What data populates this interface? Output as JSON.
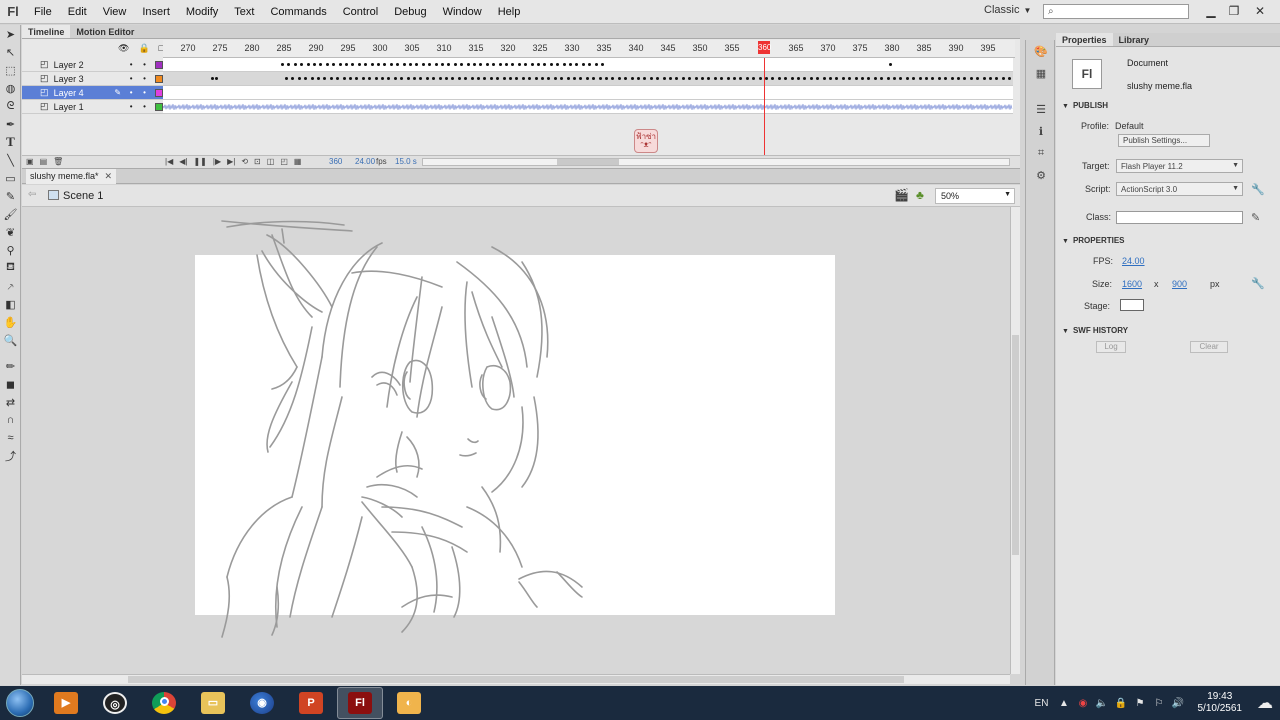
{
  "app": {
    "logo": "Fl",
    "menu": [
      "File",
      "Edit",
      "View",
      "Insert",
      "Modify",
      "Text",
      "Commands",
      "Control",
      "Debug",
      "Window",
      "Help"
    ],
    "workspace": "Classic",
    "window_controls": [
      "minimize-icon",
      "restore-icon",
      "close-icon"
    ]
  },
  "timeline": {
    "tabs": [
      "Timeline",
      "Motion Editor"
    ],
    "frame_ticks": [
      "270",
      "275",
      "280",
      "285",
      "290",
      "295",
      "300",
      "305",
      "310",
      "315",
      "320",
      "325",
      "330",
      "335",
      "340",
      "345",
      "350",
      "355",
      "360",
      "365",
      "370",
      "375",
      "380",
      "385",
      "390",
      "395"
    ],
    "current_frame_marker": "360",
    "layers": [
      {
        "name": "Layer 2",
        "color": "#a030c0",
        "selected": false
      },
      {
        "name": "Layer 3",
        "color": "#f08a20",
        "selected": false
      },
      {
        "name": "Layer 4",
        "color": "#e040e0",
        "selected": true
      },
      {
        "name": "Layer 1",
        "color": "#40c040",
        "selected": false
      }
    ],
    "footer": {
      "current_frame": "360",
      "fps": "24.00",
      "fps_unit": "fps",
      "elapsed": "15.0 s"
    },
    "onion_sprite_text": "ฟ้าซ่า"
  },
  "document": {
    "tab_title": "slushy meme.fla*",
    "scene": "Scene 1",
    "zoom": "50%"
  },
  "properties": {
    "tabs": [
      "Properties",
      "Library"
    ],
    "doc_type": "Document",
    "doc_name": "slushy meme.fla",
    "publish": {
      "header": "PUBLISH",
      "profile_label": "Profile:",
      "profile_value": "Default",
      "settings_button": "Publish Settings...",
      "target_label": "Target:",
      "target_value": "Flash Player 11.2",
      "script_label": "Script:",
      "script_value": "ActionScript 3.0",
      "class_label": "Class:"
    },
    "doc_props": {
      "header": "PROPERTIES",
      "fps_label": "FPS:",
      "fps_value": "24.00",
      "size_label": "Size:",
      "width": "1600",
      "x": "x",
      "height": "900",
      "unit": "px",
      "stage_label": "Stage:",
      "stage_color": "#ffffff"
    },
    "swf_history": {
      "header": "SWF HISTORY",
      "log_button": "Log",
      "clear_button": "Clear"
    }
  },
  "taskbar": {
    "apps": [
      "windows-media-player",
      "obs-studio",
      "chrome",
      "file-explorer",
      "firefox",
      "powerpoint",
      "flash",
      "paint"
    ],
    "language": "EN",
    "time": "19:43",
    "date": "5/10/2561"
  }
}
